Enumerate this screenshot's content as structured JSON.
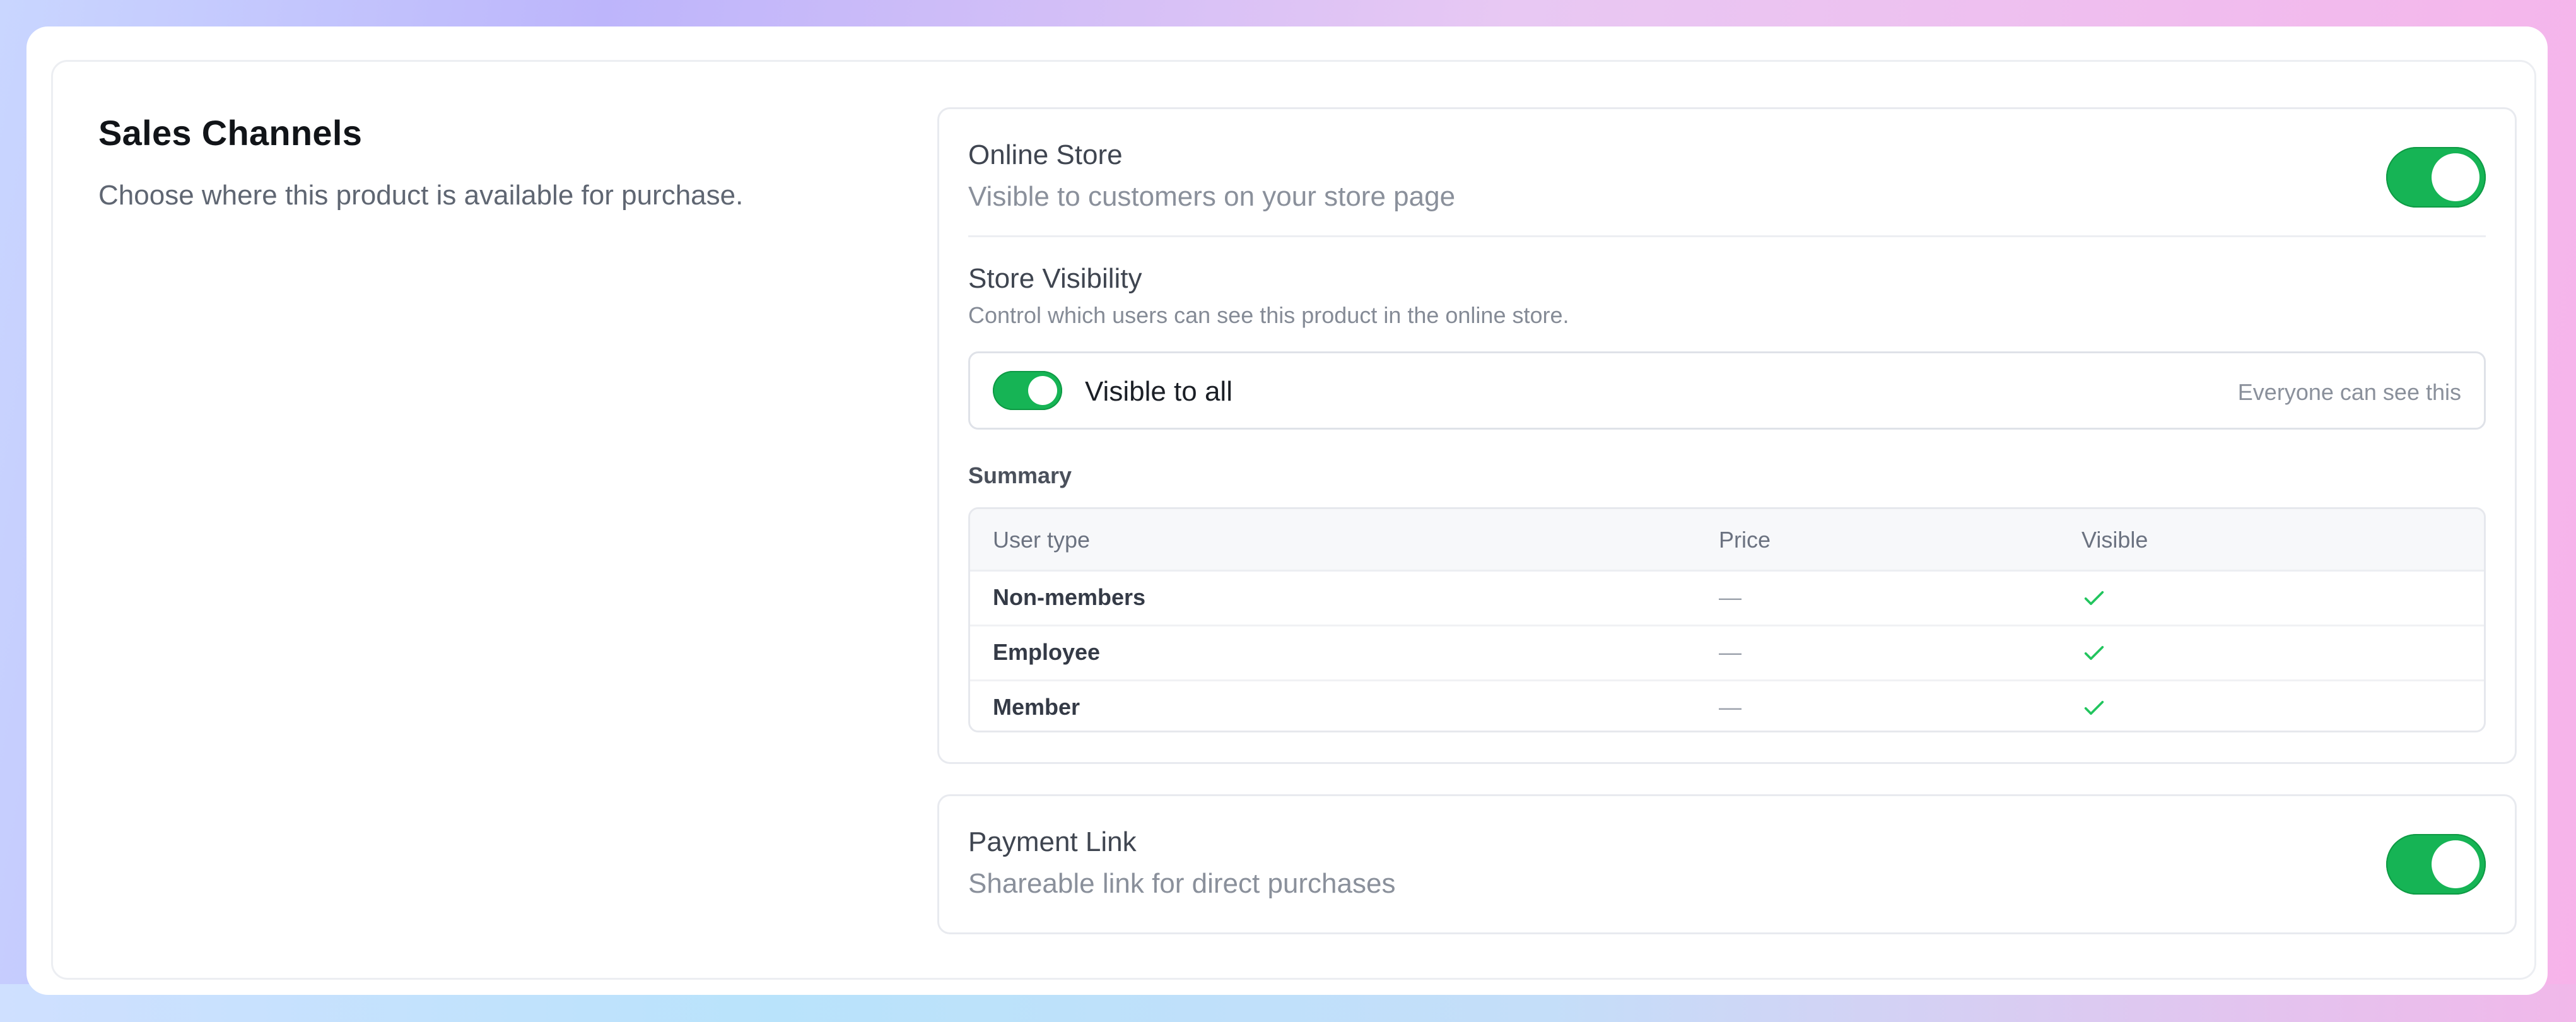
{
  "section": {
    "title": "Sales Channels",
    "description": "Choose where this product is available for purchase."
  },
  "online_store": {
    "title": "Online Store",
    "subtitle": "Visible to customers on your store page",
    "enabled": true
  },
  "store_visibility": {
    "title": "Store Visibility",
    "subtitle": "Control which users can see this product in the online store.",
    "toggle_label": "Visible to all",
    "toggle_hint": "Everyone can see this",
    "enabled": true
  },
  "summary": {
    "label": "Summary",
    "columns": [
      "User type",
      "Price",
      "Visible"
    ],
    "rows": [
      {
        "user_type": "Non-members",
        "price": "—",
        "visible": true
      },
      {
        "user_type": "Employee",
        "price": "—",
        "visible": true
      },
      {
        "user_type": "Member",
        "price": "—",
        "visible": true
      }
    ]
  },
  "payment_link": {
    "title": "Payment Link",
    "subtitle": "Shareable link for direct purchases",
    "enabled": true
  },
  "colors": {
    "toggle_on": "#16b455",
    "check": "#22c55e"
  }
}
